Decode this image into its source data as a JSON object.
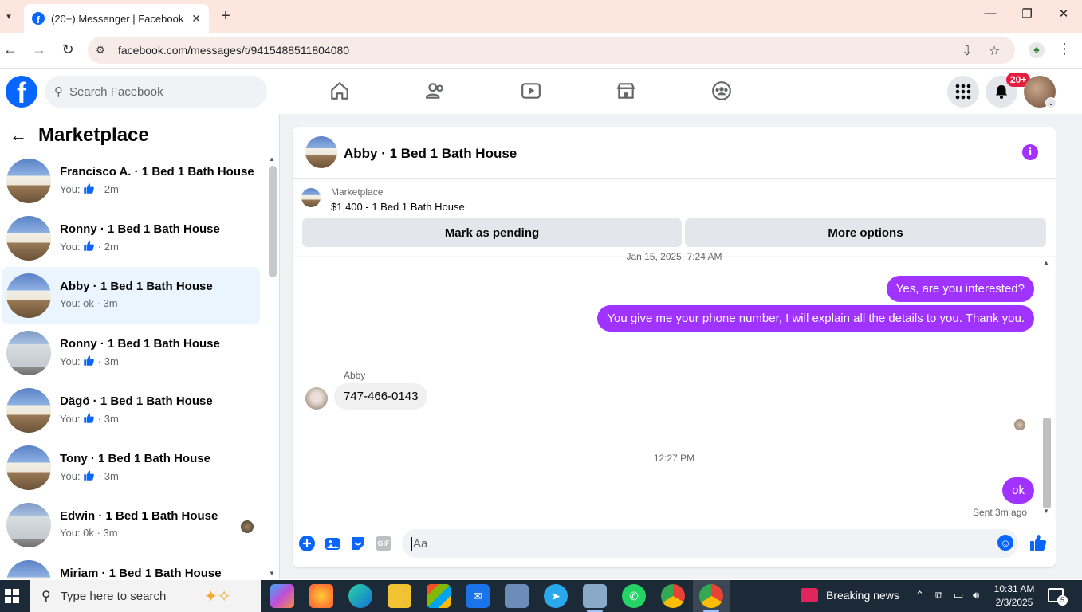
{
  "browser": {
    "tab_title": "(20+) Messenger | Facebook",
    "tab_close": "✕",
    "new_tab": "+",
    "url": "facebook.com/messages/t/9415488511804080"
  },
  "fb": {
    "search_placeholder": "Search Facebook",
    "notif_badge": "20+"
  },
  "left": {
    "title": "Marketplace",
    "conversations": [
      {
        "name": "Francisco A. · 1 Bed 1 Bath House",
        "sub_prefix": "You: ",
        "sub_text": "",
        "time": "2m",
        "liked": true,
        "thumb": "house",
        "active": false
      },
      {
        "name": "Ronny · 1 Bed 1 Bath House",
        "sub_prefix": "You: ",
        "sub_text": "",
        "time": "2m",
        "liked": true,
        "thumb": "house",
        "active": false
      },
      {
        "name": "Abby · 1 Bed 1 Bath House",
        "sub_prefix": "You: ",
        "sub_text": "ok",
        "time": "3m",
        "liked": false,
        "thumb": "house",
        "active": true
      },
      {
        "name": "Ronny · 1 Bed 1 Bath House",
        "sub_prefix": "You: ",
        "sub_text": "",
        "time": "3m",
        "liked": true,
        "thumb": "garage",
        "active": false
      },
      {
        "name": "Dägö · 1 Bed 1 Bath House",
        "sub_prefix": "You: ",
        "sub_text": "",
        "time": "3m",
        "liked": true,
        "thumb": "house",
        "active": false
      },
      {
        "name": "Tony · 1 Bed 1 Bath House",
        "sub_prefix": "You: ",
        "sub_text": "",
        "time": "3m",
        "liked": true,
        "thumb": "house",
        "active": false
      },
      {
        "name": "Edwin · 1 Bed 1 Bath House",
        "sub_prefix": "You: ",
        "sub_text": "0k",
        "time": "3m",
        "liked": false,
        "thumb": "garage",
        "active": false,
        "seen": true
      },
      {
        "name": "Miriam · 1 Bed 1 Bath House",
        "sub_prefix": "",
        "sub_text": "",
        "time": "",
        "liked": false,
        "thumb": "house",
        "active": false
      }
    ]
  },
  "chat": {
    "title": "Abby · 1 Bed 1 Bath House",
    "listing_label": "Marketplace",
    "listing_price": "$1,400 - 1 Bed 1 Bath House",
    "mark_pending": "Mark as pending",
    "more_options": "More options",
    "timestamp_top": "Jan 15, 2025, 7:24 AM",
    "out_msg_1": "Yes, are you interested?",
    "out_msg_2": "You give me your phone number, I will explain all the details to you. Thank you.",
    "sender_name": "Abby",
    "in_msg_1": "747-466-0143",
    "timestamp_2": "12:27 PM",
    "out_msg_3": "ok",
    "sent_label": "Sent 3m ago",
    "composer_placeholder": "Aa",
    "gif_label": "GIF"
  },
  "taskbar": {
    "search_placeholder": "Type here to search",
    "news_label": "Breaking news",
    "time": "10:31 AM",
    "date": "2/3/2025",
    "notif_count": "5"
  },
  "colors": {
    "accent_purple": "#a033ff",
    "fb_blue": "#0866ff",
    "active_row": "#ebf5ff"
  }
}
